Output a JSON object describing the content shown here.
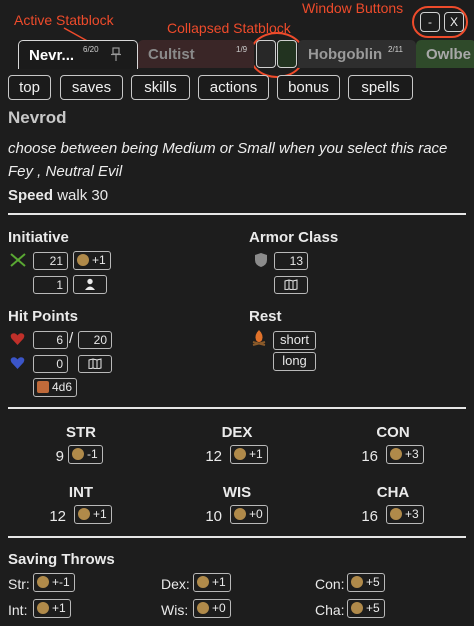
{
  "annotations": {
    "active_statblock": "Active Statblock",
    "collapsed_statblock": "Collapsed Statblock",
    "window_buttons": "Window Buttons"
  },
  "window": {
    "minimize": "-",
    "close": "X"
  },
  "tabs": [
    {
      "name": "Nevr...",
      "count": "6/20",
      "active": true
    },
    {
      "name": "Cultist",
      "count": "1/9"
    },
    {
      "name": "Hobgoblin",
      "count": "2/11"
    },
    {
      "name": "Owlbe",
      "count": ""
    }
  ],
  "nav": [
    "top",
    "saves",
    "skills",
    "actions",
    "bonus",
    "spells"
  ],
  "creature": {
    "name": "Nevrod",
    "desc1": "choose between being Medium or Small when you select this race",
    "desc2": "Fey , Neutral Evil",
    "speed_label": "Speed",
    "speed_value": "walk 30"
  },
  "initiative": {
    "label": "Initiative",
    "value": "21",
    "mod": "+1",
    "count": "1"
  },
  "armor_class": {
    "label": "Armor Class",
    "value": "13"
  },
  "hit_points": {
    "label": "Hit Points",
    "current": "6",
    "sep": "/",
    "max": "20",
    "temp": "0",
    "hit_dice": "4d6"
  },
  "rest": {
    "label": "Rest",
    "short": "short",
    "long": "long"
  },
  "abilities": [
    {
      "name": "STR",
      "score": "9",
      "mod": "-1"
    },
    {
      "name": "DEX",
      "score": "12",
      "mod": "+1"
    },
    {
      "name": "CON",
      "score": "16",
      "mod": "+3"
    },
    {
      "name": "INT",
      "score": "12",
      "mod": "+1"
    },
    {
      "name": "WIS",
      "score": "10",
      "mod": "+0"
    },
    {
      "name": "CHA",
      "score": "16",
      "mod": "+3"
    }
  ],
  "saving_throws": {
    "label": "Saving Throws",
    "items": [
      {
        "label": "Str:",
        "mod": "+-1"
      },
      {
        "label": "Dex:",
        "mod": "+1"
      },
      {
        "label": "Con:",
        "mod": "+5"
      },
      {
        "label": "Int:",
        "mod": "+1"
      },
      {
        "label": "Wis:",
        "mod": "+0"
      },
      {
        "label": "Cha:",
        "mod": "+5"
      }
    ]
  },
  "colors": {
    "annotation": "#ee4b2b",
    "background": "#1d1d1d"
  }
}
